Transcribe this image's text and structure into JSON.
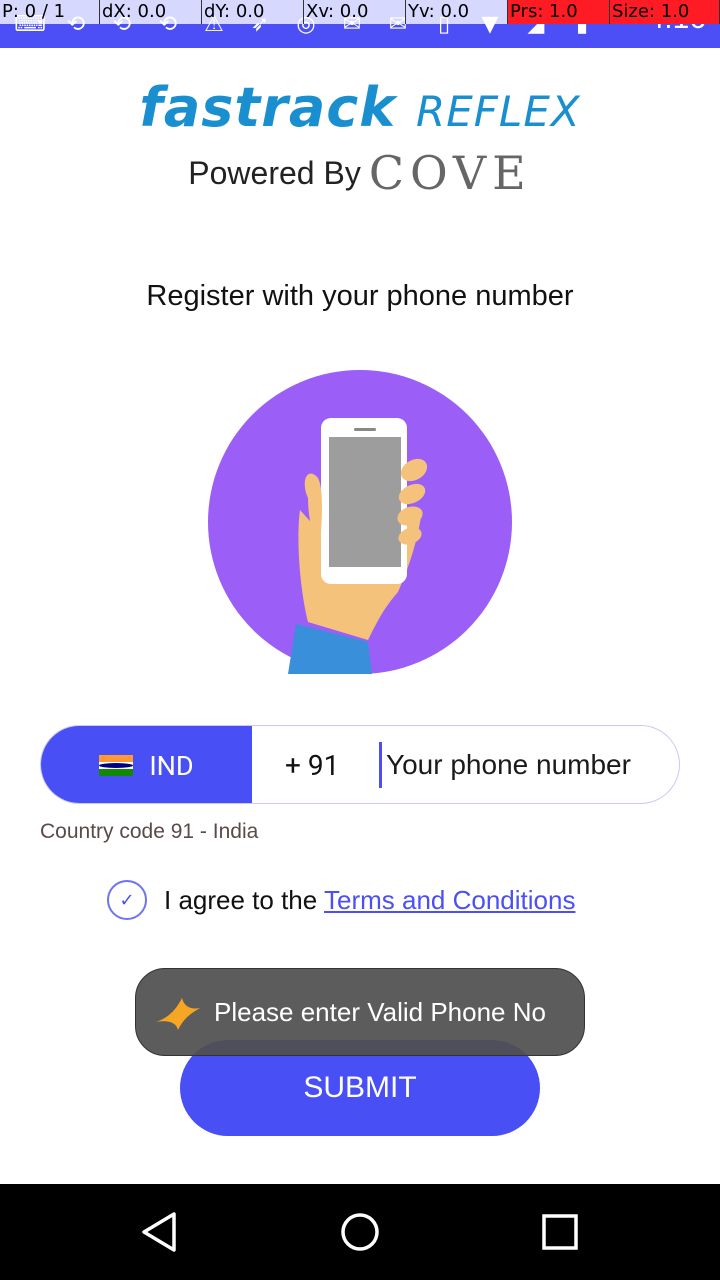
{
  "status_bar": {
    "time": "4:16",
    "debug": {
      "p": "P: 0 / 1",
      "dx": "dX: 0.0",
      "dy": "dY: 0.0",
      "xv": "Xv: 0.0",
      "yv": "Yv: 0.0",
      "prs": "Prs: 1.0",
      "size": "Size: 1.0"
    },
    "icons": [
      "keyboard-icon",
      "share-icon",
      "share-icon",
      "share-icon",
      "warning-icon",
      "fastrack-icon",
      "jio-icon",
      "mail-icon",
      "mail-icon",
      "vibrate-icon",
      "wifi-icon",
      "signal-icon",
      "battery-icon"
    ]
  },
  "logo": {
    "brand": "fastrack",
    "product": "REFLEX",
    "powered_by": "Powered By",
    "partner": "COVE"
  },
  "headline": "Register with your phone number",
  "phone_form": {
    "country_code_label": "IND",
    "dial_code": "+ 91",
    "phone_placeholder": "Your phone number",
    "country_hint": "Country code 91 - India"
  },
  "agreement": {
    "prefix": "I agree to the",
    "terms_link": "Terms and Conditions",
    "checked": true
  },
  "toast": {
    "message": "Please enter Valid Phone No"
  },
  "submit_label": "SUBMIT",
  "colors": {
    "accent": "#484ff5",
    "illustration_circle": "#9b5ef7",
    "toast_bg": "#505050"
  }
}
